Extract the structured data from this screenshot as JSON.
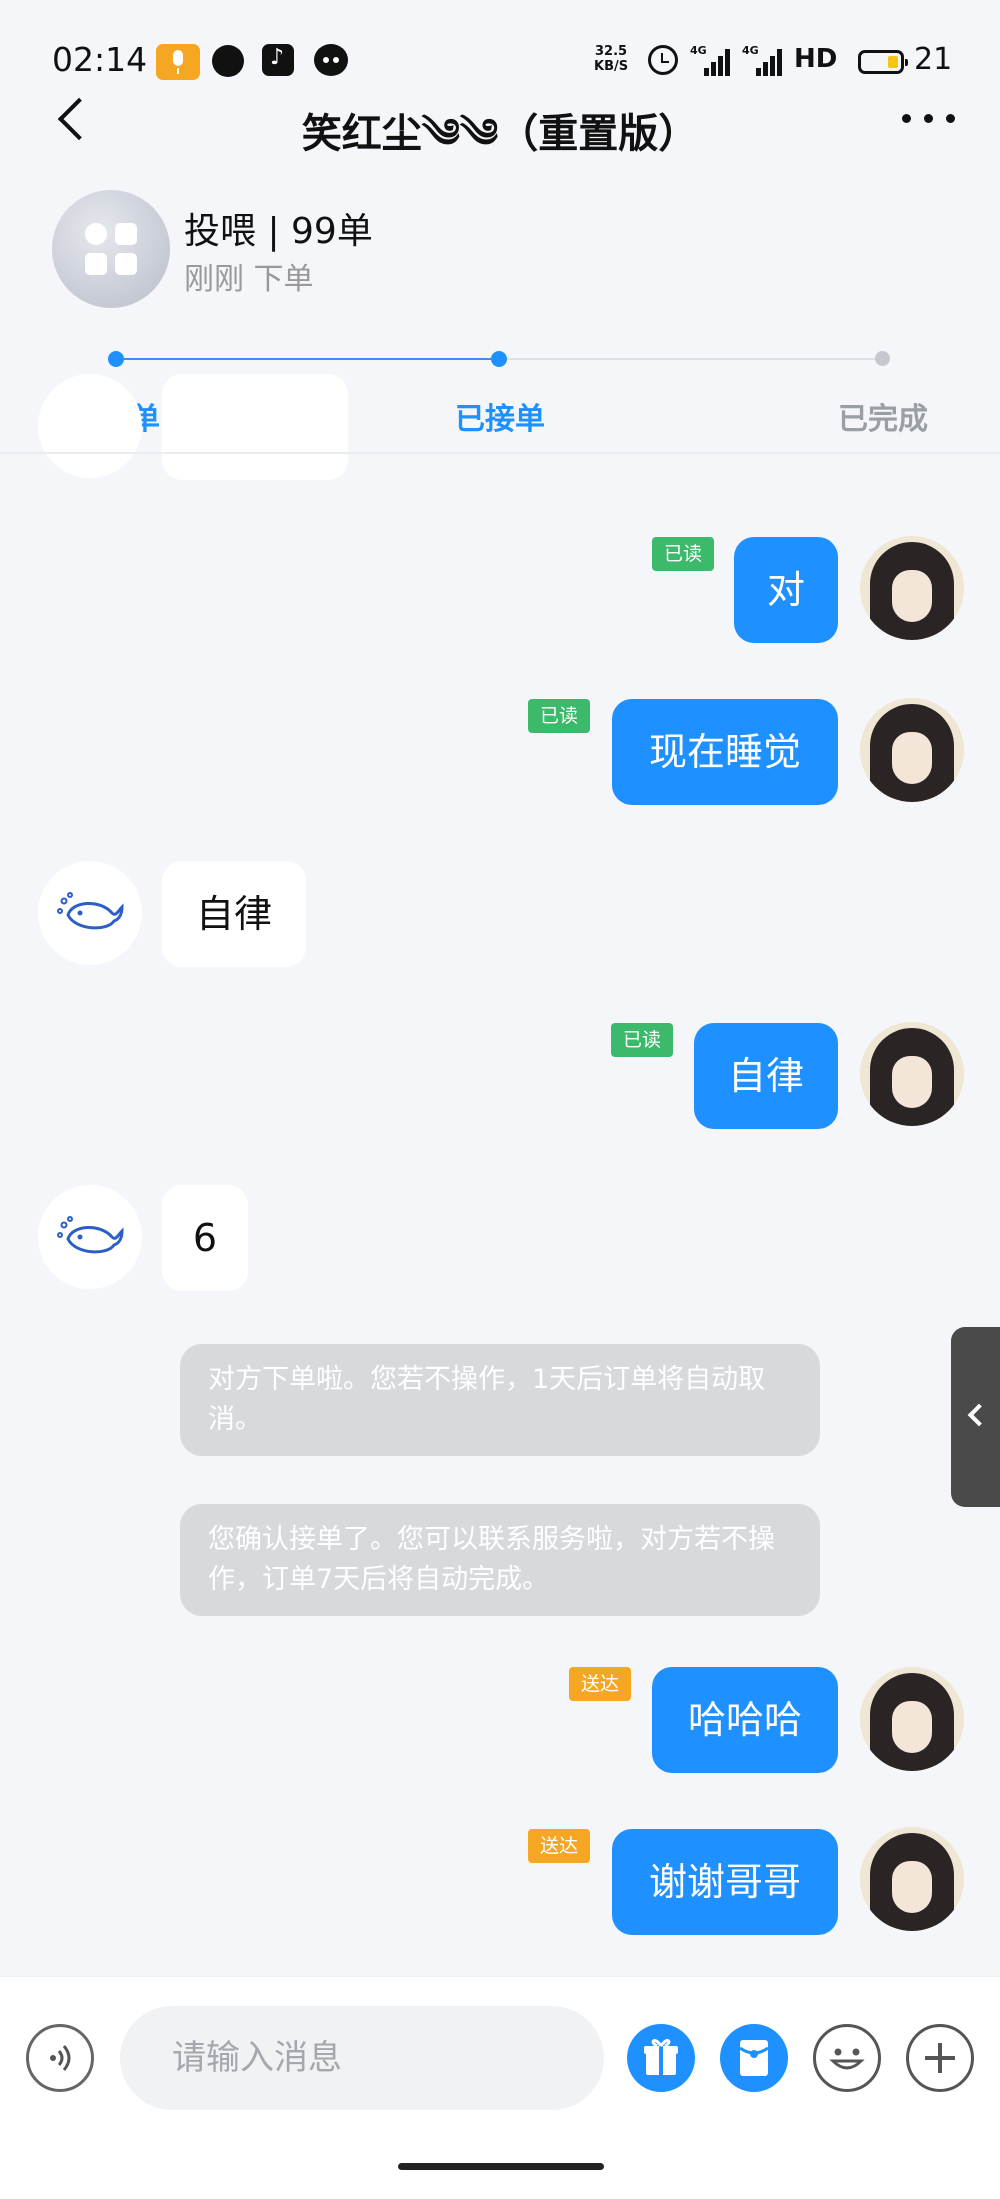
{
  "status_bar": {
    "time": "02:14",
    "speed_value": "32.5",
    "speed_unit": "KB/S",
    "network_1": "4G",
    "network_2": "4G",
    "hd": "HD",
    "battery": "21"
  },
  "nav": {
    "title": "笑红尘༄༄（重置版）"
  },
  "order": {
    "title": "投喂 | 99单",
    "subtitle": "刚刚 下单"
  },
  "progress": {
    "steps": [
      {
        "label": "待接单",
        "state": "done"
      },
      {
        "label": "已接单",
        "state": "current"
      },
      {
        "label": "已完成",
        "state": "pending"
      }
    ]
  },
  "messages": [
    {
      "type": "outgoing",
      "text": "对",
      "status": "已读"
    },
    {
      "type": "outgoing",
      "text": "现在睡觉",
      "status": "已读"
    },
    {
      "type": "incoming",
      "text": "自律"
    },
    {
      "type": "outgoing",
      "text": "自律",
      "status": "已读"
    },
    {
      "type": "incoming",
      "text": "6"
    },
    {
      "type": "system",
      "text": "对方下单啦。您若不操作，1天后订单将自动取消。"
    },
    {
      "type": "system",
      "text": "您确认接单了。您可以联系服务啦，对方若不操作，订单7天后将自动完成。"
    },
    {
      "type": "outgoing",
      "text": "哈哈哈",
      "status": "送达"
    },
    {
      "type": "outgoing",
      "text": "谢谢哥哥",
      "status": "送达"
    }
  ],
  "input": {
    "placeholder": "请输入消息",
    "value": ""
  },
  "colors": {
    "accent": "#1e90ff",
    "read_badge": "#3cb96b",
    "sent_badge": "#f5a623",
    "progress_active": "#3b8ff0",
    "progress_inactive": "#c5c9cf",
    "background": "#f4f6f9"
  },
  "icons": [
    "mic-icon",
    "bubble-icon",
    "tiktok-icon",
    "chat-icon",
    "alarm-icon",
    "signal-icon",
    "battery-icon",
    "back-icon",
    "more-icon",
    "apps-icon",
    "whale-icon",
    "chevron-left-icon",
    "voice-icon",
    "gift-icon",
    "red-packet-icon",
    "emoji-icon",
    "plus-icon"
  ]
}
